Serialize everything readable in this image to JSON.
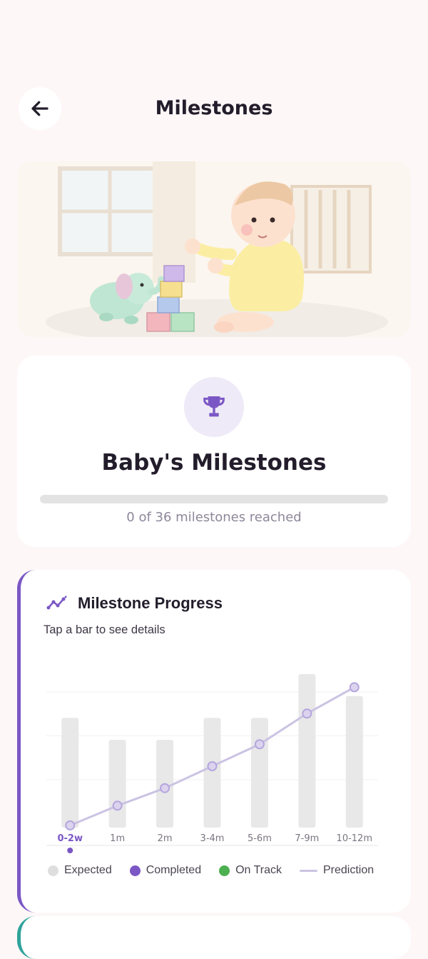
{
  "header": {
    "title": "Milestones",
    "back_icon": "arrow-left-icon"
  },
  "summary": {
    "icon": "trophy-icon",
    "title": "Baby's Milestones",
    "reached": 0,
    "total": 36,
    "progress_fraction": 0,
    "progress_text": "0 of 36 milestones reached"
  },
  "chart": {
    "title": "Milestone Progress",
    "title_icon": "trend-line-icon",
    "subtitle": "Tap a bar to see details",
    "selected": "0-2w",
    "legend": [
      {
        "label": "Expected",
        "color": "#dedede",
        "kind": "dot"
      },
      {
        "label": "Completed",
        "color": "#7b57c5",
        "kind": "dot"
      },
      {
        "label": "On Track",
        "color": "#4caf50",
        "kind": "dot"
      },
      {
        "label": "Prediction",
        "color": "#cbc3e3",
        "kind": "line"
      }
    ]
  },
  "colors": {
    "accent": "#7b57c5",
    "bar": "#e8e8e8",
    "prediction": "#cbc3e3",
    "on_track": "#4caf50"
  },
  "chart_data": {
    "type": "bar",
    "categories": [
      "0-2w",
      "1m",
      "2m",
      "3-4m",
      "5-6m",
      "7-9m",
      "10-12m"
    ],
    "series": [
      {
        "name": "Expected",
        "values": [
          5,
          4,
          4,
          5,
          5,
          7,
          6
        ]
      },
      {
        "name": "Completed",
        "values": [
          0,
          0,
          0,
          0,
          0,
          0,
          0
        ]
      },
      {
        "name": "Prediction",
        "values": [
          0.1,
          1.0,
          1.8,
          2.8,
          3.8,
          5.2,
          6.4
        ]
      }
    ],
    "ylim": [
      0,
      7
    ],
    "grid": true,
    "legend_position": "bottom"
  }
}
